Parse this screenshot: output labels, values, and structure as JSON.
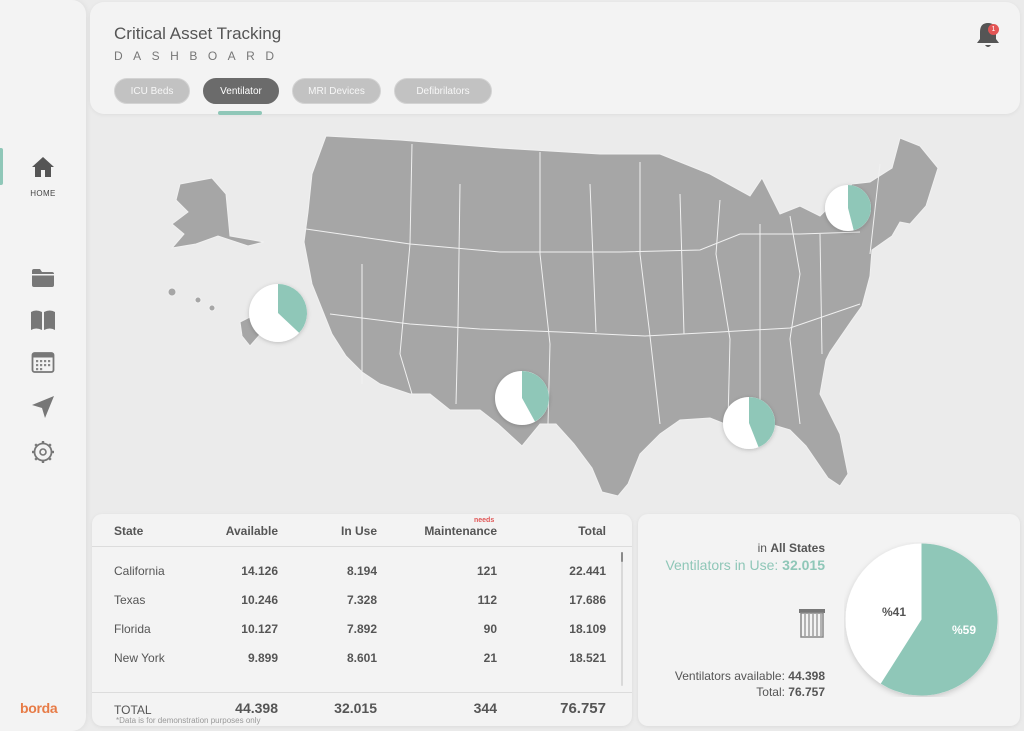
{
  "header": {
    "title": "Critical Asset Tracking",
    "subtitle": "DASHBOARD",
    "tabs": [
      {
        "label": "ICU Beds"
      },
      {
        "label": "Ventilator"
      },
      {
        "label": "MRI Devices"
      },
      {
        "label": "Defibrilators"
      }
    ],
    "active_tab": "Ventilator",
    "notification_count": "1"
  },
  "sidebar": {
    "home_label": "HOME",
    "logo": "borda",
    "icons": [
      "home-icon",
      "folder-icon",
      "book-icon",
      "calendar-icon",
      "navigation-icon",
      "settings-icon"
    ]
  },
  "map": {
    "accent_color": "#8fc7b8",
    "land_color": "#a6a6a6",
    "markers": [
      {
        "state": "California",
        "in_use_fraction": 0.37
      },
      {
        "state": "Texas",
        "in_use_fraction": 0.42
      },
      {
        "state": "Florida",
        "in_use_fraction": 0.44
      },
      {
        "state": "New York",
        "in_use_fraction": 0.46
      }
    ]
  },
  "table": {
    "headers": {
      "state": "State",
      "available": "Available",
      "in_use": "In Use",
      "maintenance": "Maintenance",
      "needs": "needs",
      "total": "Total"
    },
    "rows": [
      {
        "state": "California",
        "available": "14.126",
        "in_use": "8.194",
        "maintenance": "121",
        "total": "22.441"
      },
      {
        "state": "Texas",
        "available": "10.246",
        "in_use": "7.328",
        "maintenance": "112",
        "total": "17.686"
      },
      {
        "state": "Florida",
        "available": "10.127",
        "in_use": "7.892",
        "maintenance": "90",
        "total": "18.109"
      },
      {
        "state": "New York",
        "available": "9.899",
        "in_use": "8.601",
        "maintenance": "21",
        "total": "18.521"
      }
    ],
    "totals": {
      "label": "TOTAL",
      "available": "44.398",
      "in_use": "32.015",
      "maintenance": "344",
      "total": "76.757"
    },
    "disclaimer": "*Data is for demonstration purposes only"
  },
  "summary": {
    "scope_prefix": "in",
    "scope": "All States",
    "in_use_label": "Ventilators in Use:",
    "in_use_value": "32.015",
    "available_label": "Ventilators available:",
    "available_value": "44.398",
    "total_label": "Total:",
    "total_value": "76.757",
    "pie": {
      "in_use_percent_label": "%59",
      "available_percent_label": "%41",
      "in_use_fraction": 0.59,
      "in_use_color": "#8fc7b8",
      "available_color": "#ffffff"
    }
  }
}
